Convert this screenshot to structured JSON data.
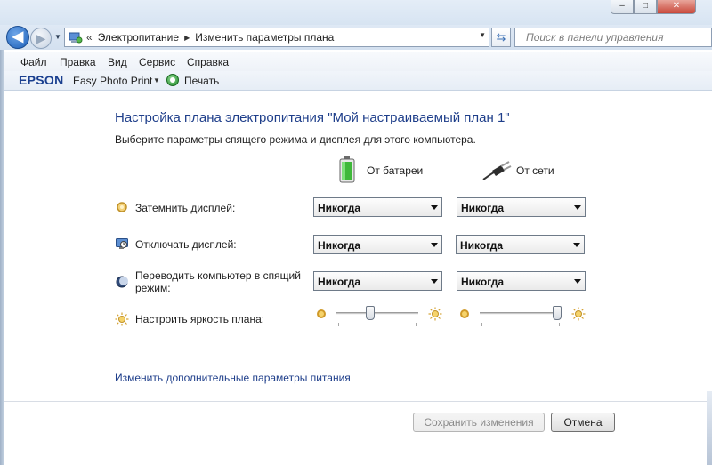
{
  "window": {
    "controls": [
      "minimize",
      "maximize",
      "close"
    ],
    "minimize_glyph": "–",
    "maximize_glyph": "□",
    "close_glyph": "✕"
  },
  "nav": {
    "back_glyph": "◀",
    "forward_glyph": "▶",
    "dropdown_glyph": "▼"
  },
  "address": {
    "chevron": "«",
    "crumbs": [
      "Электропитание",
      "Изменить параметры плана"
    ],
    "sep_glyph": "▶",
    "dropdown_glyph": "▼",
    "refresh_glyph": "⇆"
  },
  "search": {
    "placeholder": "Поиск в панели управления"
  },
  "menu": {
    "items": [
      "Файл",
      "Правка",
      "Вид",
      "Сервис",
      "Справка"
    ]
  },
  "epson": {
    "logo": "EPSON",
    "app": "Easy Photo Print",
    "dropdown_glyph": "▼",
    "print_label": "Печать"
  },
  "content": {
    "title": "Настройка плана электропитания \"Мой настраиваемый план 1\"",
    "subtitle": "Выберите параметры спящего режима и дисплея для этого компьютера.",
    "col_battery": "От батареи",
    "col_power": "От сети",
    "rows": [
      {
        "icon": "dim-display-icon",
        "label": "Затемнить дисплей:",
        "battery": "Никогда",
        "power": "Никогда"
      },
      {
        "icon": "display-off-icon",
        "label": "Отключать дисплей:",
        "battery": "Никогда",
        "power": "Никогда"
      },
      {
        "icon": "sleep-icon",
        "label": "Переводить компьютер в спящий режим:",
        "battery": "Никогда",
        "power": "Никогда"
      }
    ],
    "brightness_label": "Настроить яркость плана:",
    "brightness": {
      "battery": 0.4,
      "power": 1.0
    },
    "advanced_link": "Изменить дополнительные параметры питания"
  },
  "buttons": {
    "save": "Сохранить изменения",
    "cancel": "Отмена"
  },
  "colors": {
    "title_blue": "#1e3e8a",
    "link_blue": "#1e3e8a",
    "accent": "#1c5fb8"
  }
}
